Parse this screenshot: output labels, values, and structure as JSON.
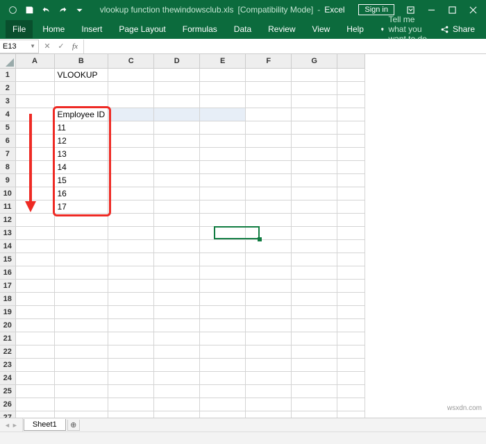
{
  "title": {
    "filename": "vlookup function thewindowsclub.xls",
    "mode": "[Compatibility Mode]",
    "app": "Excel"
  },
  "signin": "Sign in",
  "tabs": {
    "file": "File",
    "home": "Home",
    "insert": "Insert",
    "pagelayout": "Page Layout",
    "formulas": "Formulas",
    "data": "Data",
    "review": "Review",
    "view": "View",
    "help": "Help"
  },
  "tellme": "Tell me what you want to do",
  "share": "Share",
  "namebox": "E13",
  "columns": [
    "A",
    "B",
    "C",
    "D",
    "E",
    "F",
    "G"
  ],
  "rows_visible": 27,
  "cells": {
    "B1": "VLOOKUP",
    "B4": "Employee ID",
    "B5": "11",
    "B6": "12",
    "B7": "13",
    "B8": "14",
    "B9": "15",
    "B10": "16",
    "B11": "17"
  },
  "active_cell": "E13",
  "selection_range": "B4:E4",
  "sheet": {
    "name": "Sheet1"
  },
  "watermark": "wsxdn.com"
}
